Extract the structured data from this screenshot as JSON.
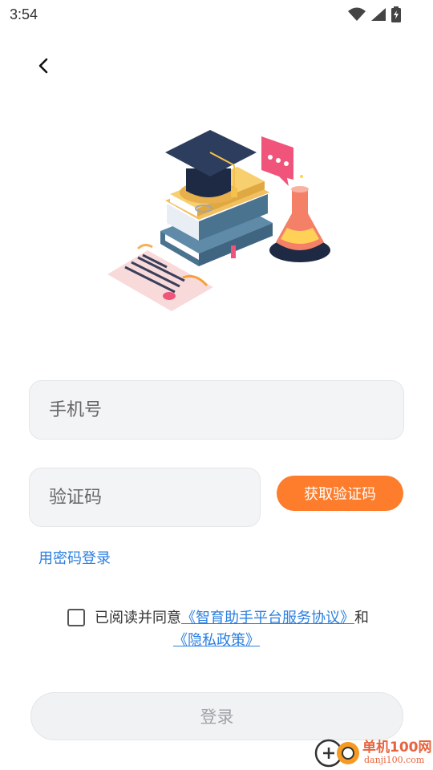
{
  "status": {
    "time": "3:54",
    "icons": [
      "wifi-icon",
      "signal-icon",
      "battery-icon"
    ]
  },
  "nav": {
    "back_icon": "chevron-left-icon"
  },
  "illustration": {
    "subject": "graduation-cap-books-flask"
  },
  "form": {
    "phone_placeholder": "手机号",
    "code_placeholder": "验证码",
    "get_code_label": "获取验证码",
    "password_login_label": "用密码登录"
  },
  "agreement": {
    "checked": false,
    "prefix": "已阅读并同意",
    "service_link": "《智育助手平台服务协议》",
    "connector": "和",
    "privacy_link": "《隐私政策》"
  },
  "login": {
    "label": "登录"
  },
  "watermark": {
    "cn": "单机100网",
    "en": "danji100.com"
  },
  "colors": {
    "accent_orange": "#fd7d2c",
    "link_blue": "#2b7fe0",
    "input_bg": "#f3f4f6",
    "disabled_text": "#a0a3a8"
  }
}
